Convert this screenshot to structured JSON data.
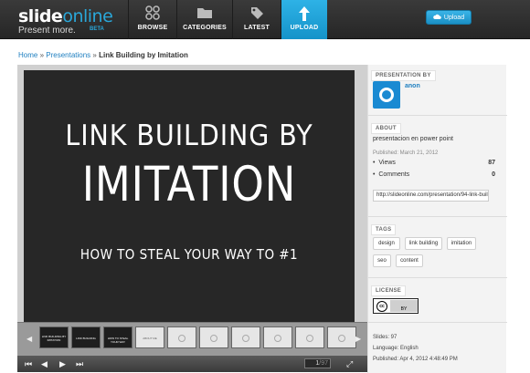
{
  "header": {
    "logo_name_a": "slide",
    "logo_name_b": "online",
    "logo_tagline": "Present more.",
    "logo_beta": "BETA",
    "nav": [
      {
        "label": "BROWSE",
        "icon": "browse-icon"
      },
      {
        "label": "CATEGORIES",
        "icon": "folder-icon"
      },
      {
        "label": "LATEST",
        "icon": "tag-icon"
      },
      {
        "label": "UPLOAD",
        "icon": "upload-arrow-icon"
      }
    ],
    "upload_button": "Upload"
  },
  "breadcrumb": {
    "home": "Home",
    "sep": "»",
    "presentations": "Presentations",
    "current": "Link Building by Imitation"
  },
  "slide": {
    "line1": "LINK BUILDING BY",
    "line2": "IMITATION",
    "line3": "HOW TO STEAL YOUR WAY TO #1"
  },
  "thumb_texts": [
    "LINK BUILDING BY IMITATION",
    "LINK BUILDING",
    "HOW TO STEAL YOUR WAY",
    "ABOUT ME"
  ],
  "controls": {
    "page_current": "1",
    "page_total": "/97"
  },
  "sidebar": {
    "presentation_by_header": "PRESENTATION BY",
    "user": "anon",
    "about_header": "ABOUT",
    "description": "presentacion en power point",
    "published_short": "Published: March 21, 2012",
    "views_label": "Views",
    "views_value": "87",
    "comments_label": "Comments",
    "comments_value": "0",
    "url": "http://slideonline.com/presentation/94-link-building-by-imitation",
    "tags_header": "TAGS",
    "tags": [
      "design",
      "link building",
      "imitation",
      "seo",
      "content"
    ],
    "license_header": "LICENSE",
    "license_cc": "cc",
    "license_by": "BY",
    "slides": "Slides: 97",
    "language": "Language: English",
    "published_full": "Published: Apr 4, 2012 4:48:49 PM"
  },
  "colors": {
    "accent": "#1d9fd6",
    "header_bg": "#2f2f2f",
    "link": "#1e7fc0",
    "slide_bg": "#272727"
  }
}
